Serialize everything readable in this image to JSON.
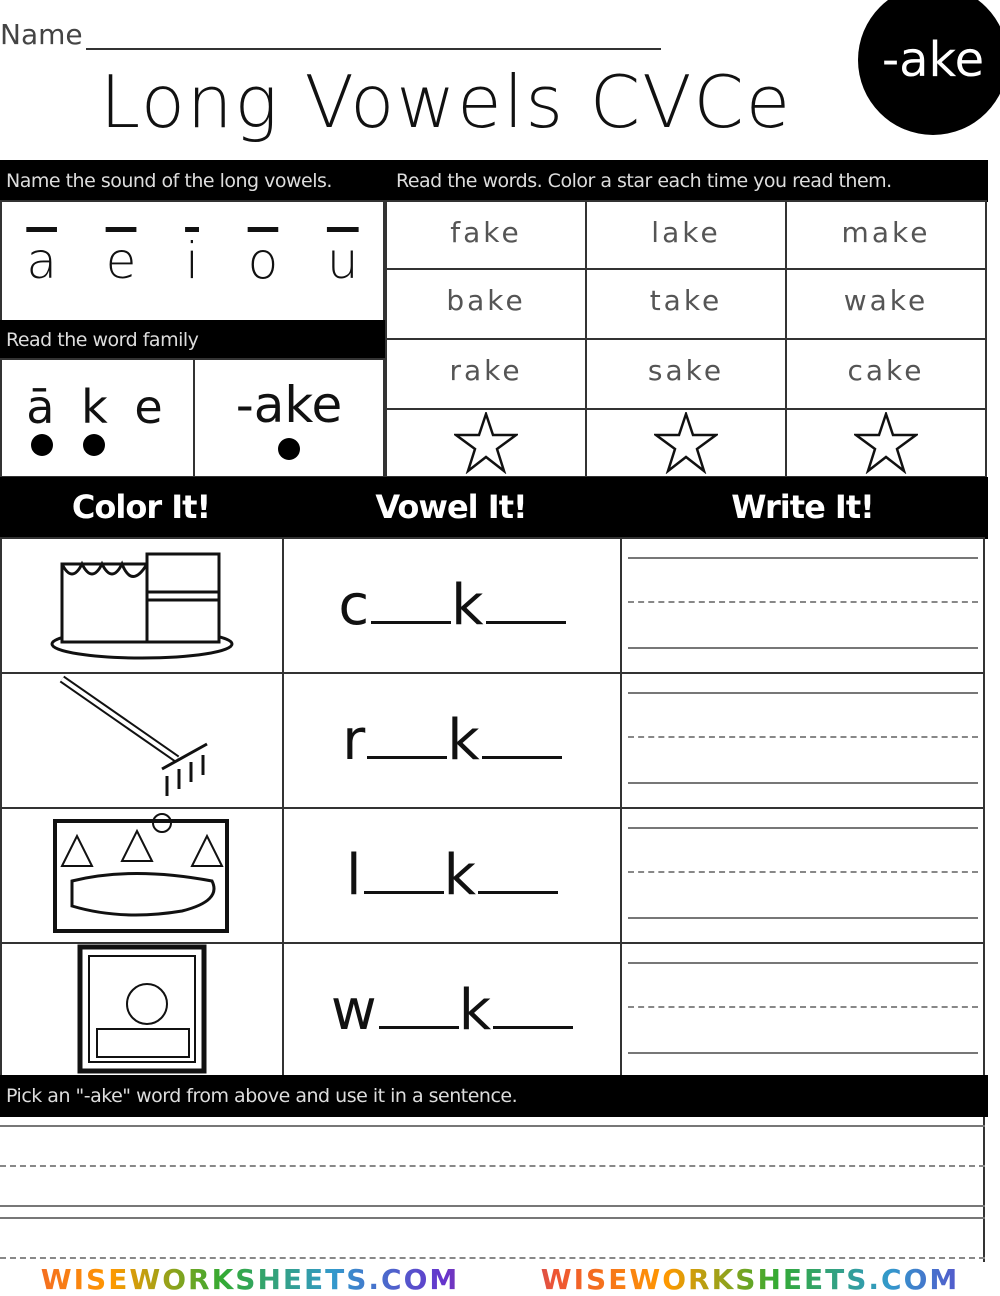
{
  "header": {
    "name_label": "Name",
    "title": "Long Vowels CVCe",
    "badge": "-ake"
  },
  "sections": {
    "vowels_instruction": "Name the sound of the long vowels.",
    "words_instruction": "Read the words. Color a star each time you read them.",
    "family_instruction": "Read the word family",
    "sentence_instruction": "Pick an \"-ake\" word from above and use it in a sentence."
  },
  "vowels": [
    "a",
    "e",
    "i",
    "o",
    "u"
  ],
  "word_family": {
    "sounded": [
      "ā",
      "k",
      "e"
    ],
    "chunked": "-ake"
  },
  "words": [
    [
      "fake",
      "lake",
      "make"
    ],
    [
      "bake",
      "take",
      "wake"
    ],
    [
      "rake",
      "sake",
      "cake"
    ]
  ],
  "stars": {
    "count": 3,
    "filled": 0,
    "icon": "star-outline-icon"
  },
  "activity_headers": [
    "Color It!",
    "Vowel It!",
    "Write It!"
  ],
  "activities": [
    {
      "picture": "cake",
      "first": "c",
      "middle": "k"
    },
    {
      "picture": "rake",
      "first": "r",
      "middle": "k"
    },
    {
      "picture": "lake",
      "first": "l",
      "middle": "k"
    },
    {
      "picture": "wake",
      "first": "w",
      "middle": "k"
    }
  ],
  "watermark": "WISEWORKSHEETS.COM"
}
